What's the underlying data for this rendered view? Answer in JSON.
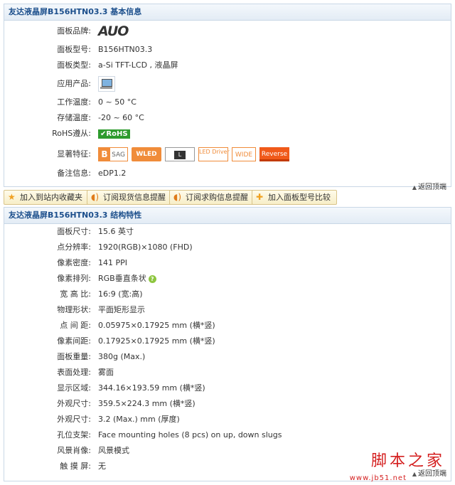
{
  "section1": {
    "title": "友达液晶屏B156HTN03.3 基本信息",
    "rows": [
      {
        "label": "面板品牌:",
        "value": ""
      },
      {
        "label": "面板型号:",
        "value": "B156HTN03.3"
      },
      {
        "label": "面板类型:",
        "value": "a-Si TFT-LCD , 液晶屏"
      },
      {
        "label": "应用产品:",
        "value": ""
      },
      {
        "label": "工作温度:",
        "value": "0 ~ 50 °C"
      },
      {
        "label": "存储温度:",
        "value": "-20 ~ 60 °C"
      },
      {
        "label": "RoHS遵从:",
        "value": ""
      },
      {
        "label": "显著特征:",
        "value": ""
      },
      {
        "label": "备注信息:",
        "value": "eDP1.2"
      }
    ],
    "brand_logo": "AUO",
    "rohs_badge": "✔RoHS",
    "features": {
      "b_letter": "B",
      "b_text": "SAG",
      "wled": "WLED",
      "l": "L",
      "led_driver": "LED Driver",
      "wide": "WIDE",
      "reverse": "Reverse"
    },
    "back_top": "返回顶端"
  },
  "toolbar": {
    "fav": "加入到站内收藏夹",
    "stock": "订阅现货信息提醒",
    "buy": "订阅求购信息提醒",
    "compare": "加入面板型号比较"
  },
  "section2": {
    "title": "友达液晶屏B156HTN03.3 结构特性",
    "rows": [
      {
        "label": "面板尺寸:",
        "value": "15.6 英寸"
      },
      {
        "label": "点分辨率:",
        "value": "1920(RGB)×1080 (FHD)"
      },
      {
        "label": "像素密度:",
        "value": "141 PPI"
      },
      {
        "label": "像素排列:",
        "value": "RGB垂直条状"
      },
      {
        "label": "宽 高 比:",
        "value": "16:9 (宽:高)"
      },
      {
        "label": "物理形状:",
        "value": "平面矩形显示"
      },
      {
        "label": "点 间 距:",
        "value": "0.05975×0.17925 mm (横*竖)"
      },
      {
        "label": "像素间距:",
        "value": "0.17925×0.17925 mm (横*竖)"
      },
      {
        "label": "面板重量:",
        "value": "380g (Max.)"
      },
      {
        "label": "表面处理:",
        "value": "雾面"
      },
      {
        "label": "显示区域:",
        "value": "344.16×193.59 mm (横*竖)"
      },
      {
        "label": "外观尺寸:",
        "value": "359.5×224.3 mm (横*竖)"
      },
      {
        "label": "外观尺寸:",
        "value": "3.2 (Max.) mm (厚度)"
      },
      {
        "label": "孔位支架:",
        "value": "Face mounting holes (8 pcs) on up, down slugs"
      },
      {
        "label": "风景肖像:",
        "value": "风景模式"
      },
      {
        "label": "触 摸 屏:",
        "value": "无"
      }
    ],
    "back_top": "返回顶端"
  },
  "watermark": {
    "text": "脚本之家",
    "url": "www.jb51.net"
  }
}
